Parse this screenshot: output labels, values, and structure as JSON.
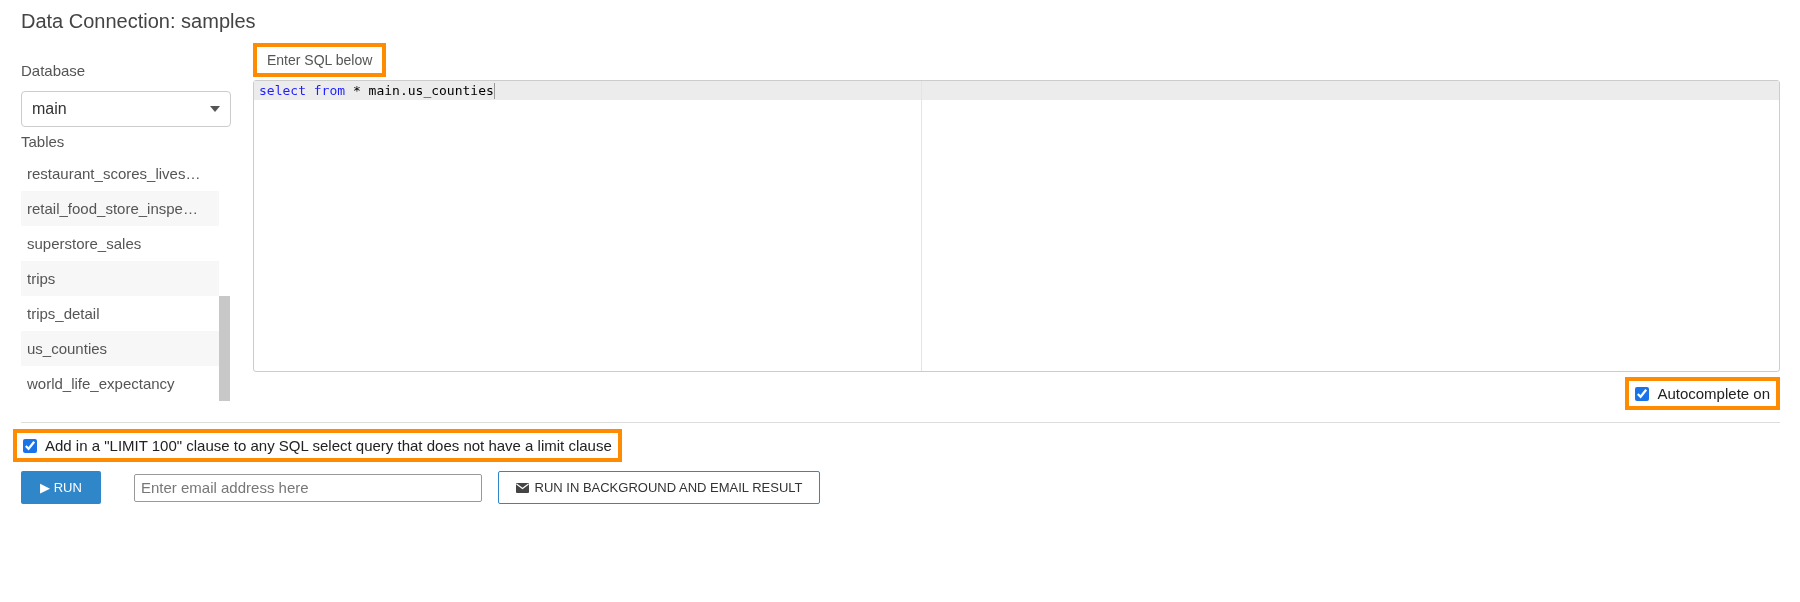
{
  "title": "Data Connection: samples",
  "database": {
    "label": "Database",
    "value": "main"
  },
  "tables": {
    "label": "Tables",
    "items": [
      {
        "name": "restaurant_scores_lives…"
      },
      {
        "name": "retail_food_store_inspe…"
      },
      {
        "name": "superstore_sales"
      },
      {
        "name": "trips"
      },
      {
        "name": "trips_detail"
      },
      {
        "name": "us_counties"
      },
      {
        "name": "world_life_expectancy"
      }
    ]
  },
  "editor": {
    "label": "Enter SQL below",
    "label_highlighted": true,
    "tokens": [
      {
        "kind": "keyword",
        "text": "select"
      },
      {
        "kind": "keyword",
        "text": "from"
      },
      {
        "kind": "plain",
        "text": "* main.us_counties"
      }
    ]
  },
  "autocomplete": {
    "label": "Autocomplete on",
    "checked": true,
    "highlighted": true
  },
  "limit_option": {
    "label": "Add in a \"LIMIT 100\" clause to any SQL select query that does not have a limit clause",
    "checked": true,
    "highlighted": true
  },
  "run_button": {
    "icon": "▶",
    "label": "RUN"
  },
  "email": {
    "placeholder": "Enter email address here"
  },
  "background_button": {
    "label": "RUN IN BACKGROUND AND EMAIL RESULT"
  }
}
